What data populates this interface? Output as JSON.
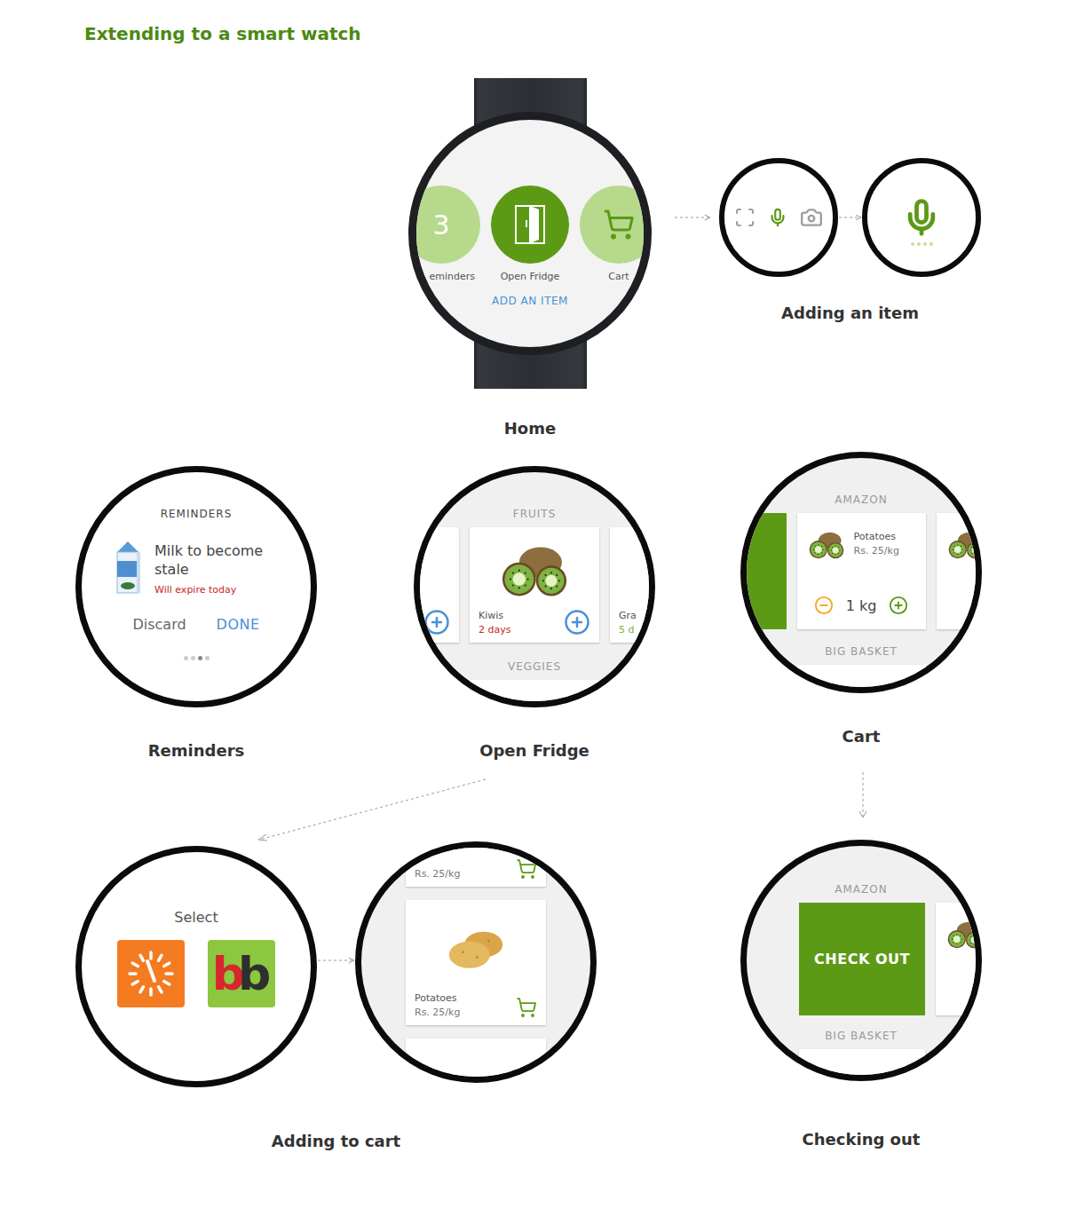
{
  "page": {
    "title": "Extending to a smart watch"
  },
  "home": {
    "caption": "Home",
    "action": "ADD AN ITEM",
    "apps": [
      {
        "kind": "reminders",
        "label": "eminders",
        "count": "3",
        "selected": false
      },
      {
        "kind": "fridge",
        "label": "Open Fridge",
        "selected": true
      },
      {
        "kind": "cart",
        "label": "Cart",
        "selected": false
      }
    ]
  },
  "adding_item": {
    "caption": "Adding an item",
    "modes": [
      {
        "kind": "scan",
        "selected": false
      },
      {
        "kind": "voice",
        "selected": true
      },
      {
        "kind": "camera",
        "selected": false
      }
    ]
  },
  "reminders": {
    "caption": "Reminders",
    "header": "REMINDERS",
    "item": {
      "title": "Milk to become stale",
      "note": "Will expire today"
    },
    "buttons": [
      {
        "label": "Discard",
        "primary": false
      },
      {
        "label": "DONE",
        "primary": true
      }
    ],
    "pages": [
      {
        "selected": false
      },
      {
        "selected": false
      },
      {
        "selected": true
      },
      {
        "selected": false
      }
    ]
  },
  "fridge": {
    "caption": "Open Fridge",
    "sections": [
      {
        "title": "FRUITS",
        "items": [
          {
            "kind": "strawberry"
          },
          {
            "kind": "kiwi",
            "name": "Kiwis",
            "days": "2 days",
            "color": "#c62828"
          },
          {
            "kind": "grapes",
            "name": "Gra",
            "days": "5 d",
            "color": "#7cb342"
          }
        ]
      },
      {
        "title": "VEGGIES",
        "items": [
          {
            "kind": "pepper"
          }
        ]
      }
    ]
  },
  "cart": {
    "caption": "Cart",
    "stores": [
      {
        "name": "AMAZON",
        "items": [
          {
            "kind": "kiwi",
            "name": "Potatoes",
            "price": "Rs. 25/kg",
            "quantity": "1 kg"
          },
          {
            "kind": "kiwi"
          }
        ]
      },
      {
        "name": "BIG BASKET",
        "items": [
          {
            "kind": "pepper"
          }
        ]
      }
    ]
  },
  "select_store": {
    "title": "Select",
    "stores": [
      {
        "kind": "clock",
        "color": "#f47b20"
      },
      {
        "kind": "letters",
        "color": "#8dc63f",
        "letters": [
          {
            "text": "b",
            "color": "#d7262e"
          },
          {
            "text": "b",
            "color": "#2f2f2f"
          }
        ]
      }
    ]
  },
  "adding_to_cart": {
    "caption": "Adding to cart",
    "items": [
      {
        "kind": "potato",
        "price": "Rs. 25/kg"
      },
      {
        "kind": "potato",
        "name": "Potatoes",
        "price": "Rs. 25/kg"
      },
      {
        "kind": "potato"
      }
    ]
  },
  "checkout": {
    "caption": "Checking out",
    "stores": [
      {
        "name": "AMAZON",
        "action": "CHECK OUT",
        "items": [
          {
            "kind": "kiwi"
          }
        ]
      },
      {
        "name": "BIG BASKET",
        "items": [
          {
            "kind": "pepper"
          }
        ]
      }
    ]
  }
}
